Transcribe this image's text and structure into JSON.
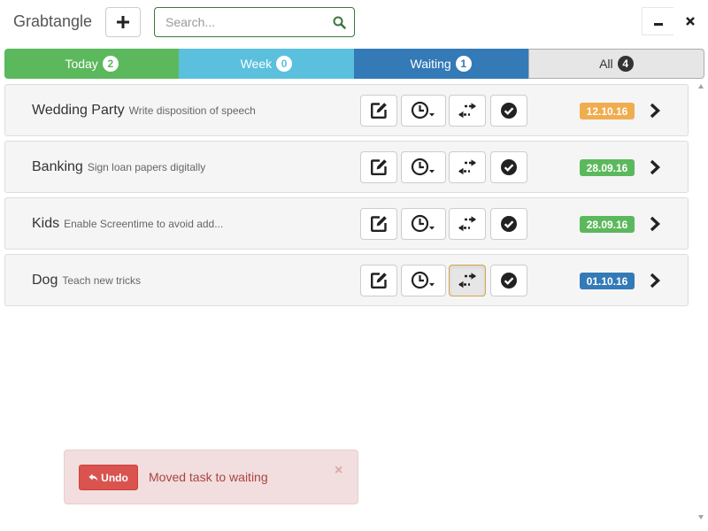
{
  "app": {
    "title": "Grabtangle"
  },
  "header": {
    "add_icon": "plus-icon",
    "search": {
      "placeholder": "Search...",
      "value": "",
      "icon": "search-icon"
    },
    "window_controls": {
      "minimize_icon": "minimize-icon",
      "close_icon": "close-icon"
    }
  },
  "tabs": [
    {
      "label": "Today",
      "count": "2",
      "color": "#5cb85c"
    },
    {
      "label": "Week",
      "count": "0",
      "color": "#5bc0de"
    },
    {
      "label": "Waiting",
      "count": "1",
      "color": "#337ab7"
    },
    {
      "label": "All",
      "count": "4",
      "color": "#e6e6e6"
    }
  ],
  "tasks": [
    {
      "title": "Wedding Party",
      "description": "Write disposition of speech",
      "date": "12.10.16",
      "date_color": "#f0ad4e",
      "move_active": false
    },
    {
      "title": "Banking",
      "description": "Sign loan papers digitally",
      "date": "28.09.16",
      "date_color": "#5cb85c",
      "move_active": false
    },
    {
      "title": "Kids",
      "description": "Enable Screentime to avoid add...",
      "date": "28.09.16",
      "date_color": "#5cb85c",
      "move_active": false
    },
    {
      "title": "Dog",
      "description": "Teach new tricks",
      "date": "01.10.16",
      "date_color": "#337ab7",
      "move_active": true
    }
  ],
  "task_actions": {
    "edit_icon": "edit-icon",
    "schedule_icon": "clock-dropdown-icon",
    "move_icon": "arrows-exchange-icon",
    "done_icon": "check-circle-icon",
    "open_icon": "chevron-right-icon"
  },
  "alert": {
    "undo_label": "Undo",
    "undo_icon": "undo-arrow-icon",
    "message": "Moved task to waiting",
    "close_symbol": "×",
    "background": "#f2dede",
    "text_color": "#a94442"
  }
}
